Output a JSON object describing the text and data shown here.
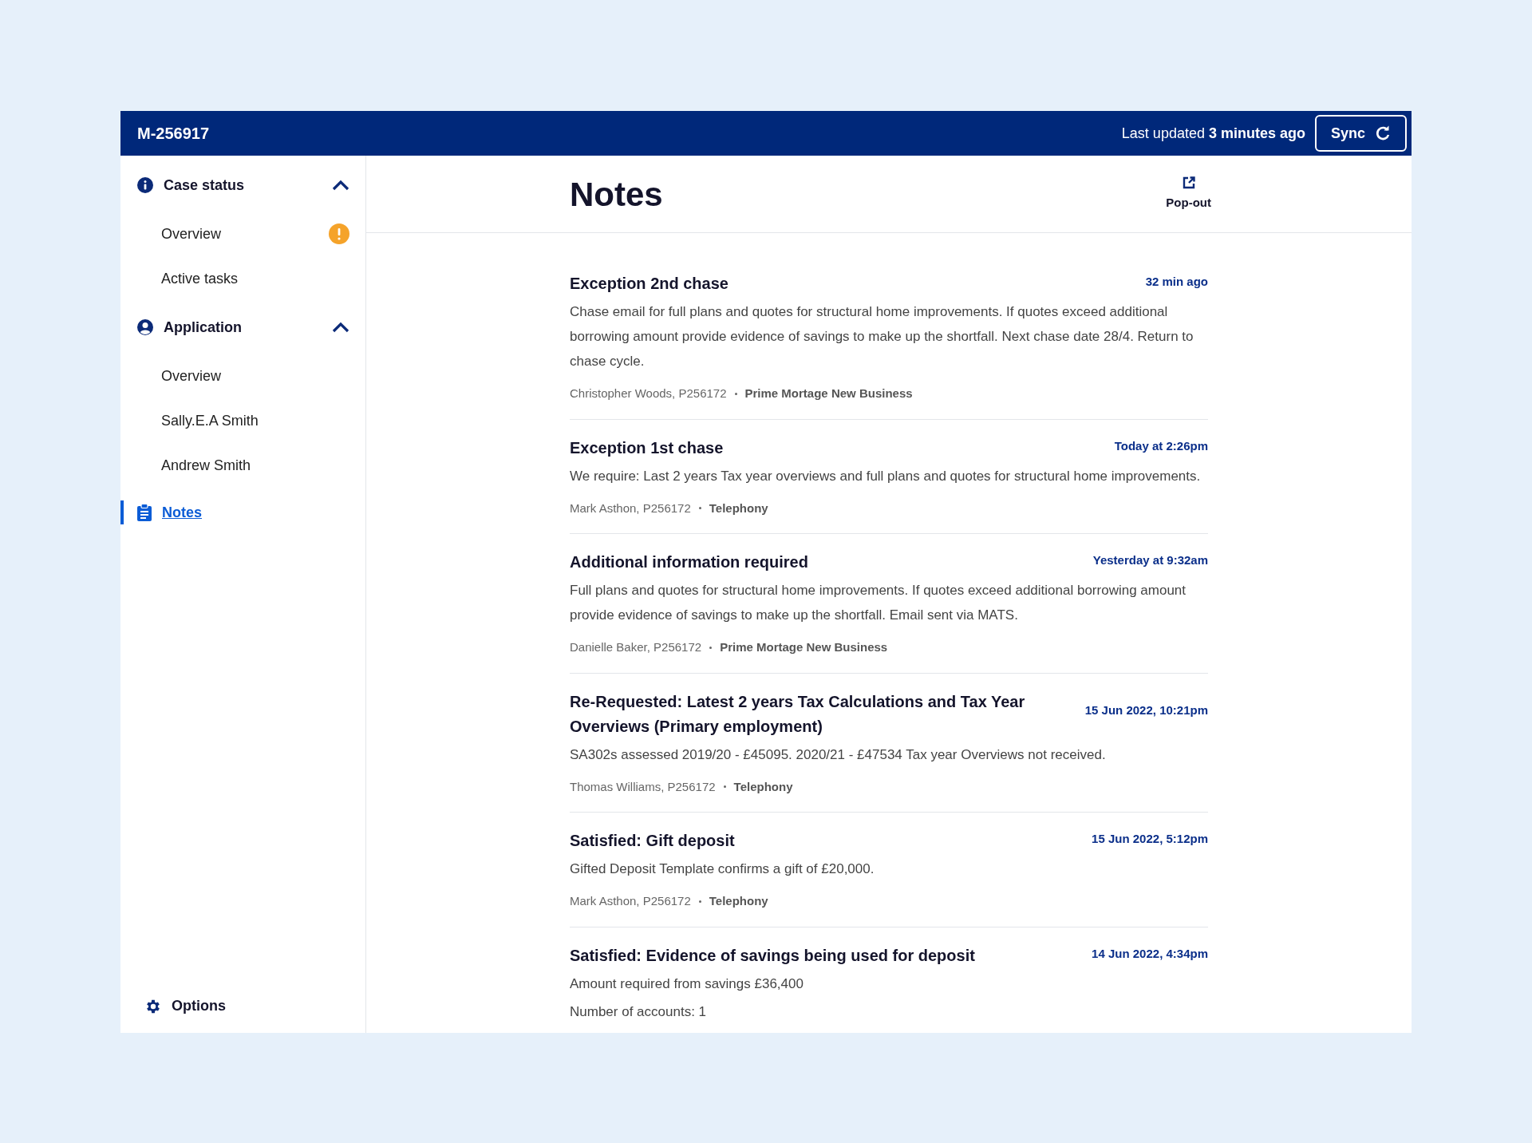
{
  "header": {
    "case_id": "M-256917",
    "last_updated": "Last updated **3 minutes ago**",
    "sync_button": "Sync"
  },
  "sidebar": {
    "sections": [
      {
        "kind": "info",
        "title": "Case status",
        "expanded": true,
        "items": [
          {
            "label": "Overview",
            "alert": true,
            "selected": false
          },
          {
            "label": "Active tasks",
            "alert": false,
            "selected": false
          }
        ]
      },
      {
        "kind": "person",
        "title": "Application",
        "expanded": true,
        "items": [
          {
            "label": "Overview",
            "alert": false,
            "selected": false
          },
          {
            "label": "Sally.E.A Smith",
            "alert": false,
            "selected": false
          },
          {
            "label": "Andrew Smith",
            "alert": false,
            "selected": false
          }
        ]
      }
    ],
    "notes_link": {
      "label": "Notes",
      "selected": true
    },
    "options": "Options"
  },
  "page": {
    "title": "Notes",
    "pop_out": "Pop-out"
  },
  "notes": [
    {
      "title": "Exception 2nd chase",
      "time": "32 min ago",
      "body": [
        "Chase email for full plans and quotes for structural home improvements. If quotes exceed additional borrowing amount provide evidence of savings to make up the shortfall. Next chase date 28/4. Return to chase cycle."
      ],
      "author": "Christopher Woods, P256172",
      "team": "Prime Mortage New Business"
    },
    {
      "title": "Exception 1st chase",
      "time": "Today at 2:26pm",
      "body": [
        "We require: Last 2 years Tax year overviews and full plans and quotes for structural home improvements."
      ],
      "author": "Mark Asthon, P256172",
      "team": "Telephony"
    },
    {
      "title": "Additional information required",
      "time": "Yesterday at 9:32am",
      "body": [
        "Full plans and quotes for structural home improvements. If quotes exceed additional borrowing amount provide evidence of savings to make up the shortfall. Email sent via MATS."
      ],
      "author": "Danielle Baker, P256172",
      "team": "Prime Mortage New Business"
    },
    {
      "title": "Re-Requested: Latest 2 years Tax Calculations and Tax Year Overviews (Primary employment)",
      "time": "15 Jun 2022, 10:21pm",
      "body": [
        "SA302s assessed 2019/20 - £45095. 2020/21 - £47534 Tax year Overviews not received."
      ],
      "author": "Thomas Williams, P256172",
      "team": "Telephony"
    },
    {
      "title": "Satisfied: Gift deposit",
      "time": "15 Jun 2022, 5:12pm",
      "body": [
        "Gifted Deposit Template confirms a gift of £20,000."
      ],
      "author": "Mark Asthon, P256172",
      "team": "Telephony"
    },
    {
      "title": "Satisfied: Evidence of savings being used for deposit",
      "time": "14 Jun 2022, 4:34pm",
      "body": [
        "Amount required from savings £36,400",
        "Number of accounts: 1"
      ]
    }
  ]
}
